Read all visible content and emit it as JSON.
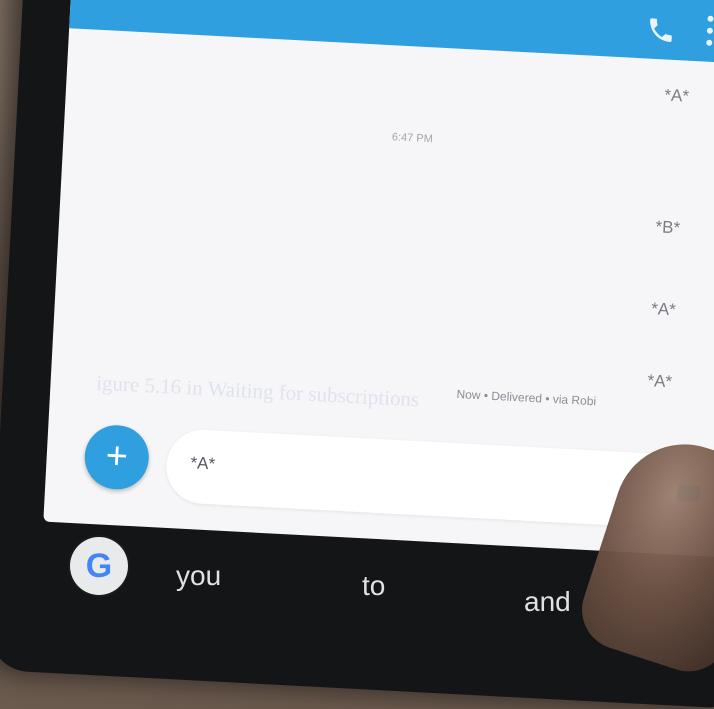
{
  "header": {
    "title": "",
    "call_icon": "phone-icon",
    "menu_icon": "more-vert-icon",
    "accent": "#2f9fe0"
  },
  "messages": [
    {
      "text": "*A*"
    },
    {
      "text": "*B*"
    },
    {
      "text": "*A*"
    },
    {
      "text": "*A*"
    }
  ],
  "timestamp": "6:47 PM",
  "delivery_status": "Now • Delivered • via Robi",
  "composer": {
    "add_icon": "plus-icon",
    "text": "*A*"
  },
  "keyboard": {
    "logo": "G",
    "suggestions": [
      "you",
      "to",
      "and"
    ]
  },
  "watermark": "igure 5.16 in Waiting for subscriptions"
}
